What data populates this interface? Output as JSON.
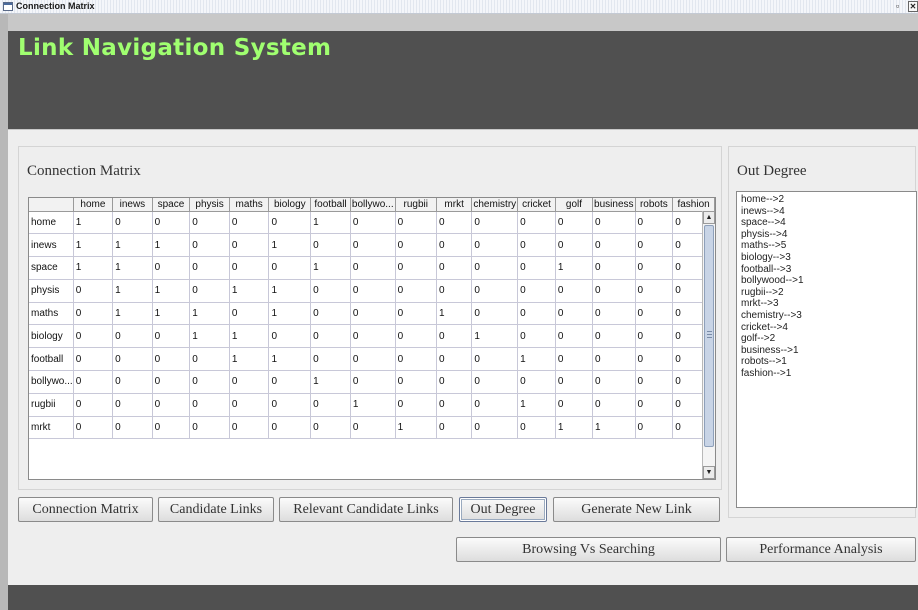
{
  "window": {
    "title": "Connection Matrix",
    "restore_glyph": "▫",
    "close_glyph": "✕"
  },
  "header": {
    "title": "Link Navigation System"
  },
  "matrix_panel": {
    "title": "Connection Matrix",
    "columns": [
      "",
      "home",
      "inews",
      "space",
      "physis",
      "maths",
      "biology",
      "football",
      "bollywo...",
      "rugbii",
      "mrkt",
      "chemistry",
      "cricket",
      "golf",
      "business",
      "robots",
      "fashion"
    ],
    "rows": [
      [
        "home",
        "1",
        "0",
        "0",
        "0",
        "0",
        "0",
        "1",
        "0",
        "0",
        "0",
        "0",
        "0",
        "0",
        "0",
        "0",
        "0"
      ],
      [
        "inews",
        "1",
        "1",
        "1",
        "0",
        "0",
        "1",
        "0",
        "0",
        "0",
        "0",
        "0",
        "0",
        "0",
        "0",
        "0",
        "0"
      ],
      [
        "space",
        "1",
        "1",
        "0",
        "0",
        "0",
        "0",
        "1",
        "0",
        "0",
        "0",
        "0",
        "0",
        "1",
        "0",
        "0",
        "0"
      ],
      [
        "physis",
        "0",
        "1",
        "1",
        "0",
        "1",
        "1",
        "0",
        "0",
        "0",
        "0",
        "0",
        "0",
        "0",
        "0",
        "0",
        "0"
      ],
      [
        "maths",
        "0",
        "1",
        "1",
        "1",
        "0",
        "1",
        "0",
        "0",
        "0",
        "1",
        "0",
        "0",
        "0",
        "0",
        "0",
        "0"
      ],
      [
        "biology",
        "0",
        "0",
        "0",
        "1",
        "1",
        "0",
        "0",
        "0",
        "0",
        "0",
        "1",
        "0",
        "0",
        "0",
        "0",
        "0"
      ],
      [
        "football",
        "0",
        "0",
        "0",
        "0",
        "1",
        "1",
        "0",
        "0",
        "0",
        "0",
        "0",
        "1",
        "0",
        "0",
        "0",
        "0"
      ],
      [
        "bollywo...",
        "0",
        "0",
        "0",
        "0",
        "0",
        "0",
        "1",
        "0",
        "0",
        "0",
        "0",
        "0",
        "0",
        "0",
        "0",
        "0"
      ],
      [
        "rugbii",
        "0",
        "0",
        "0",
        "0",
        "0",
        "0",
        "0",
        "1",
        "0",
        "0",
        "0",
        "1",
        "0",
        "0",
        "0",
        "0"
      ],
      [
        "mrkt",
        "0",
        "0",
        "0",
        "0",
        "0",
        "0",
        "0",
        "0",
        "1",
        "0",
        "0",
        "0",
        "1",
        "1",
        "0",
        "0"
      ]
    ],
    "scroll_up_glyph": "▲",
    "scroll_down_glyph": "▼"
  },
  "outdegree_panel": {
    "title": "Out Degree",
    "items": [
      "home-->2",
      "inews-->4",
      "space-->4",
      "physis-->4",
      "maths-->5",
      "biology-->3",
      "football-->3",
      "bollywood-->1",
      "rugbii-->2",
      "mrkt-->3",
      "chemistry-->3",
      "cricket-->4",
      "golf-->2",
      "business-->1",
      "robots-->1",
      "fashion-->1"
    ]
  },
  "buttons": {
    "connection_matrix": "Connection Matrix",
    "candidate_links": "Candidate Links",
    "relevant_candidate_links": "Relevant Candidate Links",
    "out_degree": "Out Degree",
    "generate_new_link": "Generate New Link",
    "browsing_vs_searching": "Browsing Vs Searching",
    "performance_analysis": "Performance Analysis"
  },
  "colors": {
    "header_bg": "#505050",
    "title_green": "#a0ff70",
    "panel_bg": "#eeeeee"
  }
}
